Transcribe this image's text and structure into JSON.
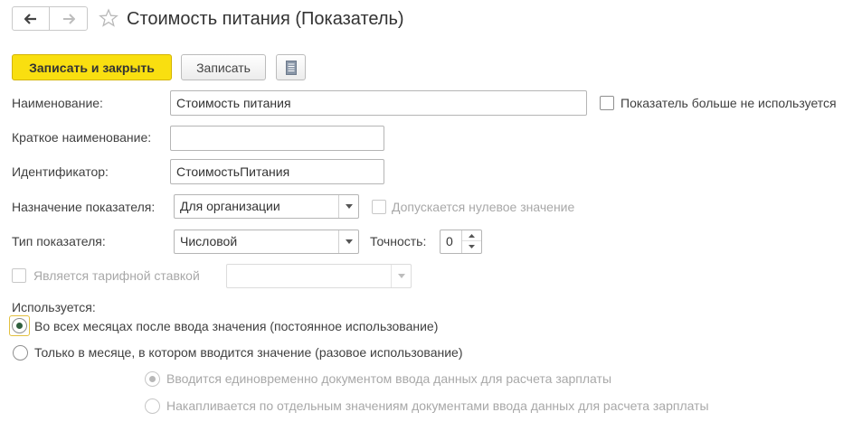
{
  "header": {
    "title": "Стоимость питания (Показатель)",
    "back_icon": "arrow-left-icon",
    "forward_icon": "arrow-right-icon",
    "favorite_icon": "star-icon"
  },
  "toolbar": {
    "save_close_label": "Записать и закрыть",
    "save_label": "Записать",
    "report_icon": "document-list-icon"
  },
  "form": {
    "name_label": "Наименование:",
    "name_value": "Стоимость питания",
    "not_used_label": "Показатель больше не используется",
    "not_used_checked": false,
    "short_name_label": "Краткое наименование:",
    "short_name_value": "",
    "identifier_label": "Идентификатор:",
    "identifier_value": "СтоимостьПитания",
    "purpose_label": "Назначение показателя:",
    "purpose_value": "Для организации",
    "zero_allowed_label": "Допускается нулевое значение",
    "zero_allowed_checked": false,
    "type_label": "Тип показателя:",
    "type_value": "Числовой",
    "precision_label": "Точность:",
    "precision_value": "0",
    "tariff_label": "Является тарифной ставкой",
    "tariff_checked": false,
    "tariff_value": ""
  },
  "usage": {
    "label": "Используется:",
    "option_permanent": "Во всех месяцах после ввода значения (постоянное использование)",
    "option_once": "Только в месяце, в котором вводится значение (разовое использование)",
    "selected": "permanent",
    "sub_option_single": "Вводится единовременно документом ввода данных для расчета зарплаты",
    "sub_option_accumulated": "Накапливается по отдельным значениям документами ввода данных для расчета зарплаты",
    "sub_selected": "single"
  },
  "colors": {
    "primary_button": "#f9df10",
    "radio_selected": "#2f5f3e",
    "focus_frame": "#e2c040",
    "disabled_text": "#a8a8a8"
  }
}
